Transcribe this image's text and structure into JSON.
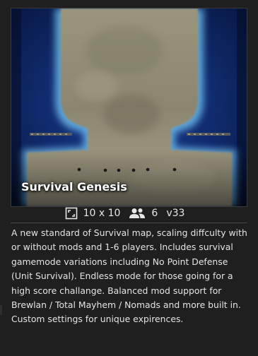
{
  "map": {
    "title": "Survival Genesis",
    "size": "10 x 10",
    "players": "6",
    "version": "v33",
    "description": "A new standard of Survival map, scaling diffculty with or without mods and 1-6 players. Includes survival gamemode variations including No Point Defense (Unit Survival). Endless mode for those going for a high score challange. Balanced mod support for Brewlan / Total Mayhem / Nomads and more built in. Custom settings for unique expirences."
  },
  "icons": {
    "size": "map-size-icon",
    "players": "players-icon"
  },
  "colors": {
    "background": "#1f1f1f",
    "water": "#0b2a6a",
    "land": "#8e8a73",
    "glow": "#8fe0ff"
  }
}
